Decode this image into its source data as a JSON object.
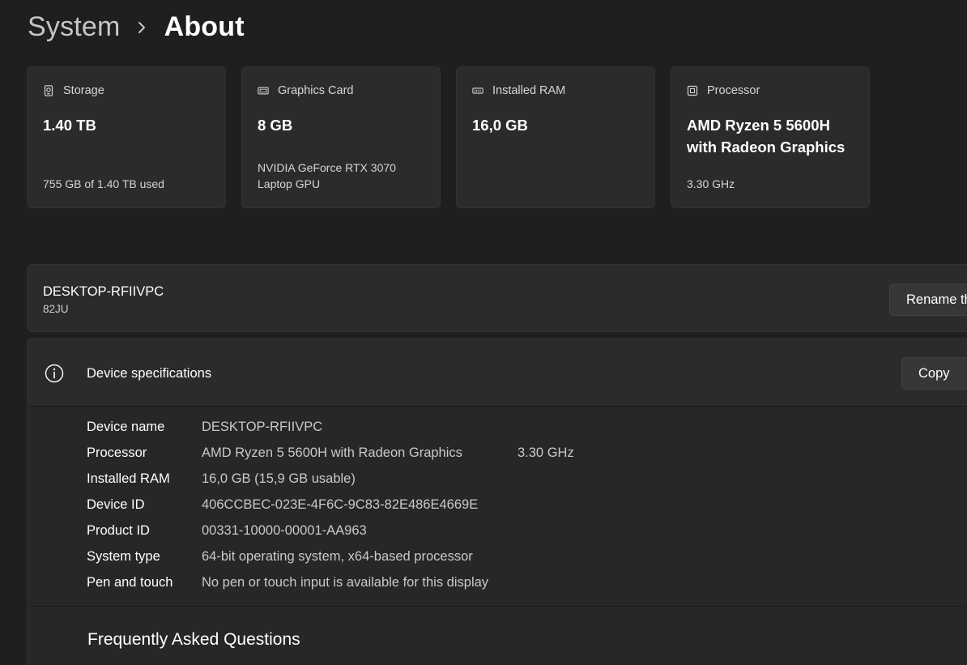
{
  "breadcrumb": {
    "parent": "System",
    "separator_icon": "chevron-right-icon",
    "current": "About"
  },
  "cards": [
    {
      "icon": "storage-icon",
      "label": "Storage",
      "value": "1.40 TB",
      "sub": "755 GB of 1.40 TB used"
    },
    {
      "icon": "graphics-card-icon",
      "label": "Graphics Card",
      "value": "8 GB",
      "sub": "NVIDIA GeForce RTX 3070 Laptop GPU"
    },
    {
      "icon": "memory-icon",
      "label": "Installed RAM",
      "value": "16,0 GB",
      "sub": ""
    },
    {
      "icon": "processor-icon",
      "label": "Processor",
      "value": "AMD Ryzen 5 5600H with Radeon Graphics",
      "sub": "3.30 GHz"
    }
  ],
  "device": {
    "name": "DESKTOP-RFIIVPC",
    "model": "82JU",
    "rename_label": "Rename this PC"
  },
  "specs": {
    "icon": "info-icon",
    "title": "Device specifications",
    "copy_label": "Copy",
    "rows": [
      {
        "key": "Device name",
        "value": "DESKTOP-RFIIVPC",
        "extra": ""
      },
      {
        "key": "Processor",
        "value": "AMD Ryzen 5 5600H with Radeon Graphics",
        "extra": "3.30 GHz"
      },
      {
        "key": "Installed RAM",
        "value": "16,0 GB (15,9 GB usable)",
        "extra": ""
      },
      {
        "key": "Device ID",
        "value": "406CCBEC-023E-4F6C-9C83-82E486E4669E",
        "extra": ""
      },
      {
        "key": "Product ID",
        "value": "00331-10000-00001-AA963",
        "extra": ""
      },
      {
        "key": "System type",
        "value": "64-bit operating system, x64-based processor",
        "extra": ""
      },
      {
        "key": "Pen and touch",
        "value": "No pen or touch input is available for this display",
        "extra": ""
      }
    ]
  },
  "faq": {
    "title": "Frequently Asked Questions"
  }
}
